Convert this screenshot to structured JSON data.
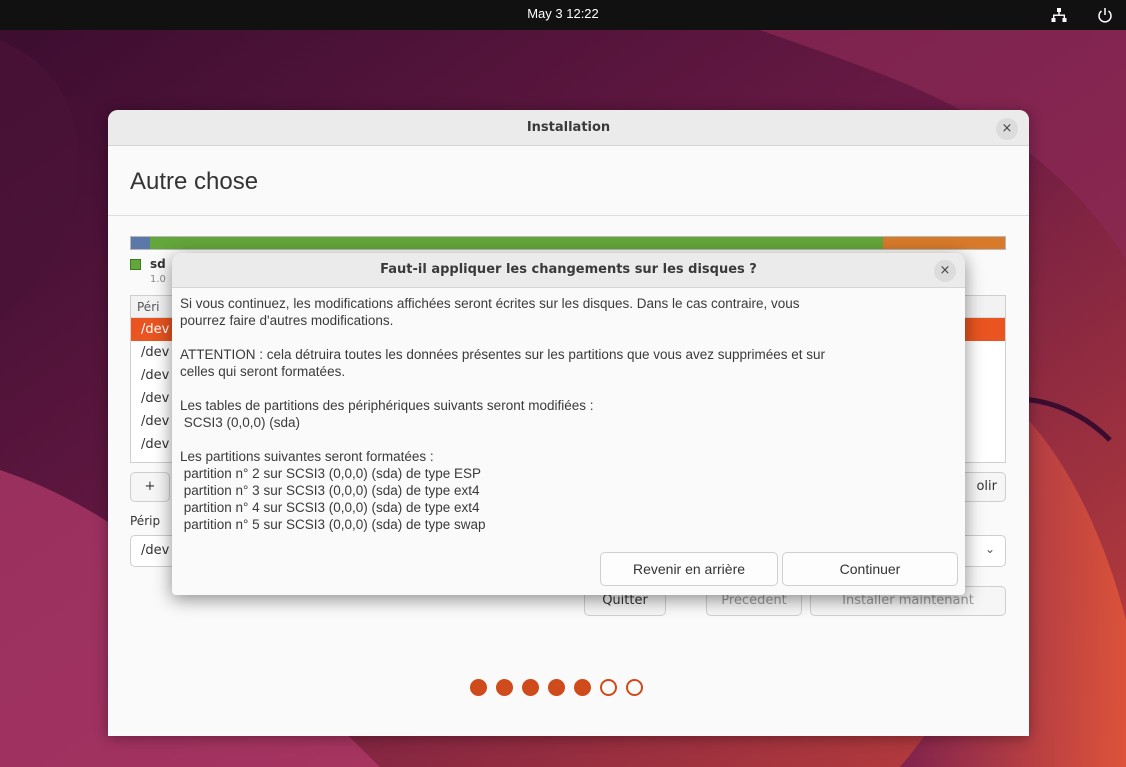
{
  "topbar": {
    "clock": "May 3  12:22",
    "network_icon": "network-wired-icon",
    "power_icon": "power-icon"
  },
  "window": {
    "title": "Installation",
    "heading": "Autre chose",
    "disk_label": "sd",
    "disk_sublabel": "1.0",
    "table_header": "Péri",
    "rows": [
      "/dev",
      "/dev",
      "/dev",
      "/dev",
      "/dev",
      "/dev"
    ],
    "add_button": "+",
    "restore_button_partial": "olir",
    "device_label": "Périp",
    "device_value": "/dev",
    "quit_button": "Quitter",
    "back_button": "Précédent",
    "install_button": "Installer maintenant",
    "progress": {
      "total_steps": 7,
      "completed_steps": 5
    }
  },
  "dialog": {
    "title": "Faut-il appliquer les changements sur les disques ?",
    "para1": [
      "Si vous continuez, les modifications affichées seront écrites sur les disques. Dans le cas contraire, vous",
      "pourrez faire d'autres modifications."
    ],
    "para2": [
      "ATTENTION : cela détruira toutes les données présentes sur les partitions que vous avez supprimées et sur",
      "celles qui seront formatées."
    ],
    "para3": [
      "Les tables de partitions des périphériques suivants seront modifiées :",
      " SCSI3 (0,0,0) (sda)"
    ],
    "para4": [
      "Les partitions suivantes seront formatées :",
      " partition n° 2 sur SCSI3 (0,0,0) (sda) de type ESP",
      " partition n° 3 sur SCSI3 (0,0,0) (sda) de type ext4",
      " partition n° 4 sur SCSI3 (0,0,0) (sda) de type ext4",
      " partition n° 5 sur SCSI3 (0,0,0) (sda) de type swap"
    ],
    "go_back_button": "Revenir en arrière",
    "continue_button": "Continuer"
  },
  "colors": {
    "accent": "#e95420",
    "dot": "#cf4b1b",
    "disk_blue": "#5a78a8",
    "disk_green": "#63a63a",
    "disk_orange": "#d87a2a"
  }
}
